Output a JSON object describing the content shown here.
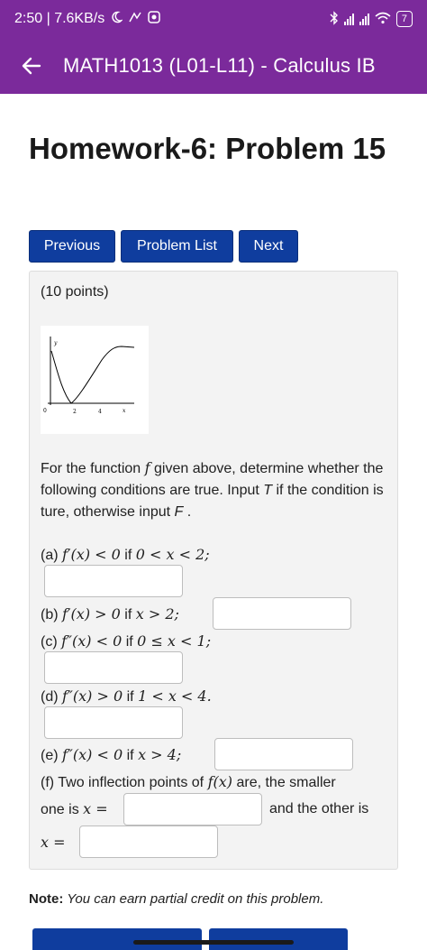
{
  "status": {
    "time_speed": "2:50 | 7.6KB/s",
    "signal1": "4G",
    "signal2": "4G",
    "battery": "7"
  },
  "appbar": {
    "title": "MATH1013 (L01-L11) - Calculus IB"
  },
  "page": {
    "title": "Homework-6: Problem 15",
    "nav": {
      "previous": "Previous",
      "problem_list": "Problem List",
      "next": "Next"
    }
  },
  "problem": {
    "points": "(10 points)",
    "graph": {
      "y_label": "y",
      "x_label": "x",
      "ticks": [
        "0",
        "2",
        "4"
      ]
    },
    "prompt_a": "For the function ",
    "prompt_f": "f",
    "prompt_b": " given above, determine whether the following conditions are true. Input ",
    "prompt_T": "T",
    "prompt_c": " if the condition is ture, otherwise input ",
    "prompt_F": "F",
    "prompt_d": " .",
    "parts": {
      "a_label": "(a) ",
      "a_expr": "f′(x) < 0",
      "a_if": " if ",
      "a_cond": "0 < x < 2;",
      "b_label": "(b) ",
      "b_expr": "f′(x) > 0",
      "b_if": " if ",
      "b_cond": "x > 2;",
      "c_label": "(c) ",
      "c_expr": "f″(x) < 0",
      "c_if": " if ",
      "c_cond": "0 ≤ x < 1;",
      "d_label": "(d) ",
      "d_expr": "f″(x) > 0",
      "d_if": " if ",
      "d_cond": "1 < x < 4.",
      "e_label": "(e) ",
      "e_expr": "f″(x) < 0",
      "e_if": " if ",
      "e_cond": "x > 4;",
      "f_text1": "(f) Two inflection points of ",
      "f_expr": "f(x)",
      "f_text2": " are, the smaller",
      "f_text3": "one is ",
      "f_x1": "x =",
      "f_text4": "and the other is",
      "f_x2": "x ="
    }
  },
  "note": {
    "bold": "Note:",
    "italic": " You can earn partial credit on this problem."
  }
}
